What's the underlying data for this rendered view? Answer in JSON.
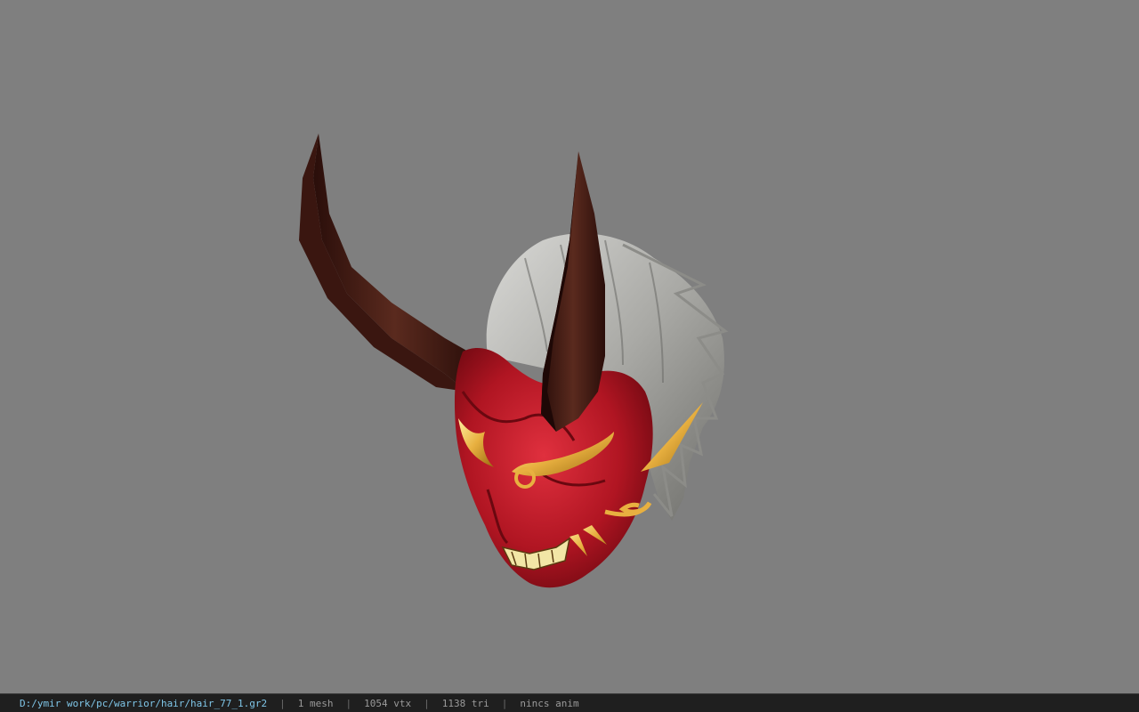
{
  "viewport": {
    "background_color": "#7f7f7f",
    "model_name": "oni-mask-hair-icon"
  },
  "status_bar": {
    "file_path": "D:/ymir work/pc/warrior/hair/hair_77_1.gr2",
    "separator": "|",
    "mesh_count": "1 mesh",
    "vertex_count": "1054 vtx",
    "triangle_count": "1138 tri",
    "anim_info": "nincs anim",
    "path_color": "#7fc6e8",
    "text_color": "#9a9a9a"
  }
}
